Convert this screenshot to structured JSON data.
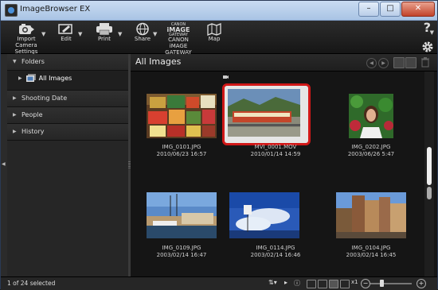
{
  "window": {
    "title": "ImageBrowser EX",
    "minimize": "–",
    "maximize": "□",
    "close": "✕"
  },
  "toolbar": {
    "import_line1": "Import",
    "import_line2": "Camera Settings",
    "edit": "Edit",
    "print": "Print",
    "share": "Share",
    "gateway_logo_top": "CANON",
    "gateway_logo_mid": "iMAGE",
    "gateway_logo_bot": "GATEWAY",
    "gateway_line1": "CANON iMAGE",
    "gateway_line2": "GATEWAY",
    "map": "Map",
    "help": "?"
  },
  "sidebar": {
    "folders": "Folders",
    "all_images": "All Images",
    "shooting_date": "Shooting Date",
    "people": "People",
    "history": "History"
  },
  "main": {
    "title": "All Images",
    "items": [
      {
        "name": "IMG_0101.JPG",
        "date": "2010/06/23 16:57"
      },
      {
        "name": "MVI_0001.MOV",
        "date": "2010/01/14 14:59"
      },
      {
        "name": "IMG_0202.JPG",
        "date": "2003/06/26 5:47"
      },
      {
        "name": "IMG_0109.JPG",
        "date": "2003/02/14 16:47"
      },
      {
        "name": "IMG_0114.JPG",
        "date": "2003/02/14 16:46"
      },
      {
        "name": "IMG_0104.JPG",
        "date": "2003/02/14 16:45"
      }
    ]
  },
  "status": {
    "selection": "1 of 24 selected",
    "zoom_label": "x1"
  },
  "colors": {
    "selection_border": "#d01818",
    "background": "#151515"
  }
}
